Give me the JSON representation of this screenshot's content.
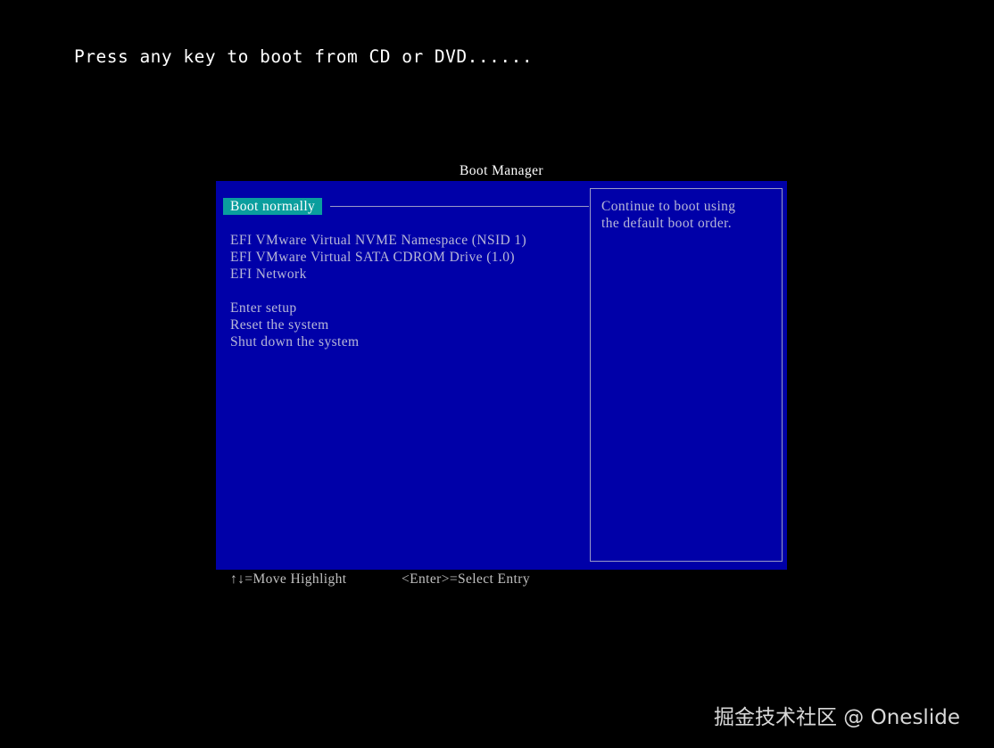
{
  "boot_prompt": "Press any key to boot from CD or DVD......",
  "boot_manager": {
    "title": "Boot Manager",
    "selected_entry": "Boot normally",
    "entries": [
      "EFI VMware Virtual NVME Namespace (NSID 1)",
      "EFI VMware Virtual SATA CDROM Drive (1.0)",
      "EFI Network",
      "Enter setup",
      "Reset the system",
      "Shut down the system"
    ],
    "help_text": [
      "Continue to boot using",
      "the default boot order."
    ]
  },
  "footer": {
    "move_hint": "↑↓=Move Highlight",
    "select_hint": "<Enter>=Select Entry"
  },
  "watermark": "掘金技术社区 @ Oneslide",
  "colors": {
    "background": "#000000",
    "panel": "#0000a8",
    "highlight": "#0a9e9e",
    "text": "#b8b8d8"
  }
}
